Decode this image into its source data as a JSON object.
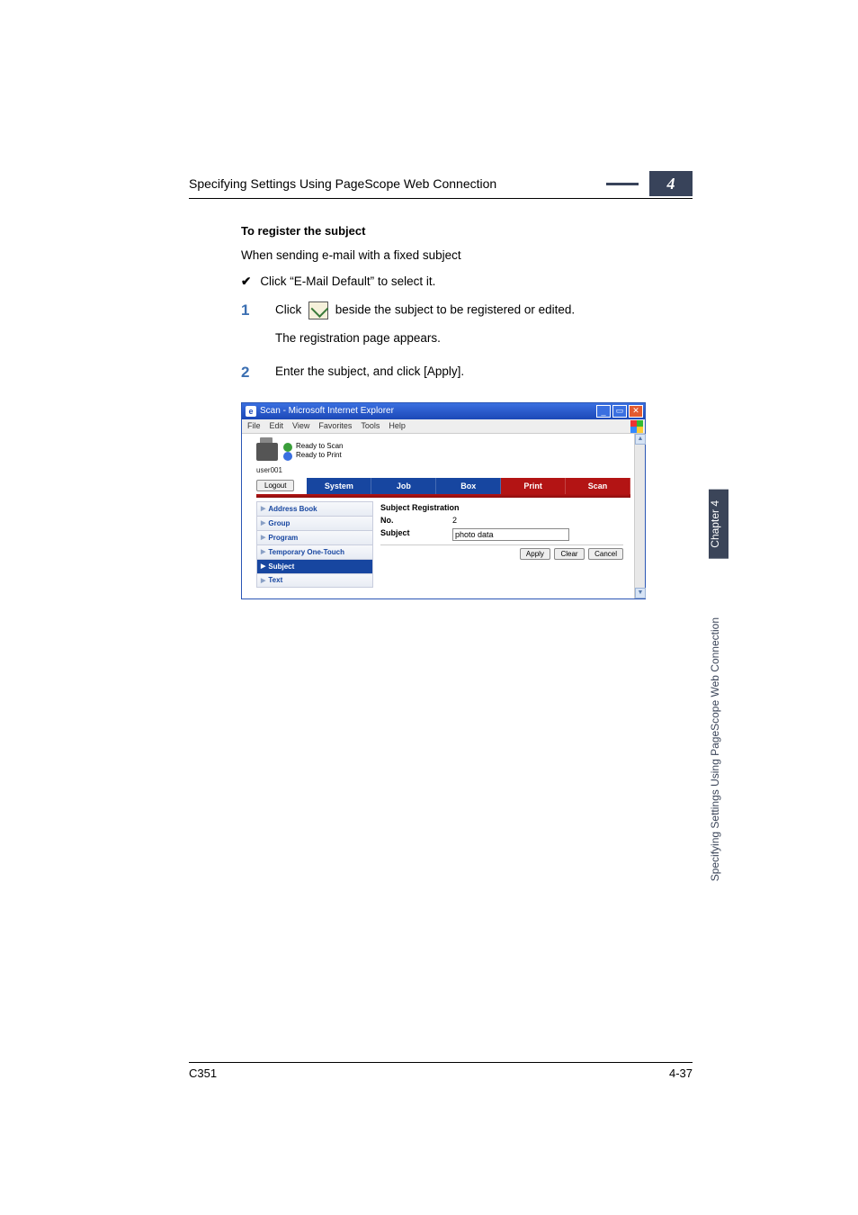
{
  "header": {
    "running_title": "Specifying Settings Using PageScope Web Connection",
    "chapter_number": "4"
  },
  "section": {
    "heading": "To register the subject",
    "intro": "When sending e-mail with a fixed subject",
    "check_text": "Click “E-Mail Default” to select it."
  },
  "steps": [
    {
      "num": "1",
      "line1_before": "Click ",
      "line1_after": " beside the subject to be registered or edited.",
      "line2": "The registration page appears."
    },
    {
      "num": "2",
      "line1": "Enter the subject, and click [Apply]."
    }
  ],
  "browser": {
    "title": "Scan - Microsoft Internet Explorer",
    "menus": [
      "File",
      "Edit",
      "View",
      "Favorites",
      "Tools",
      "Help"
    ],
    "status": {
      "scan": "Ready to Scan",
      "print": "Ready to Print"
    },
    "user": "user001",
    "logout": "Logout",
    "tabs": {
      "system": "System",
      "job": "Job",
      "box": "Box",
      "print": "Print",
      "scan": "Scan"
    },
    "sidenav": [
      "Address Book",
      "Group",
      "Program",
      "Temporary One-Touch",
      "Subject",
      "Text"
    ],
    "panel_title": "Subject Registration",
    "fields": {
      "no_label": "No.",
      "no_value": "2",
      "subject_label": "Subject",
      "subject_value": "photo data"
    },
    "buttons": {
      "apply": "Apply",
      "clear": "Clear",
      "cancel": "Cancel"
    }
  },
  "sidetab": {
    "chapter": "Chapter 4",
    "title": "Specifying Settings Using PageScope Web Connection"
  },
  "footer": {
    "left": "C351",
    "right": "4-37"
  }
}
